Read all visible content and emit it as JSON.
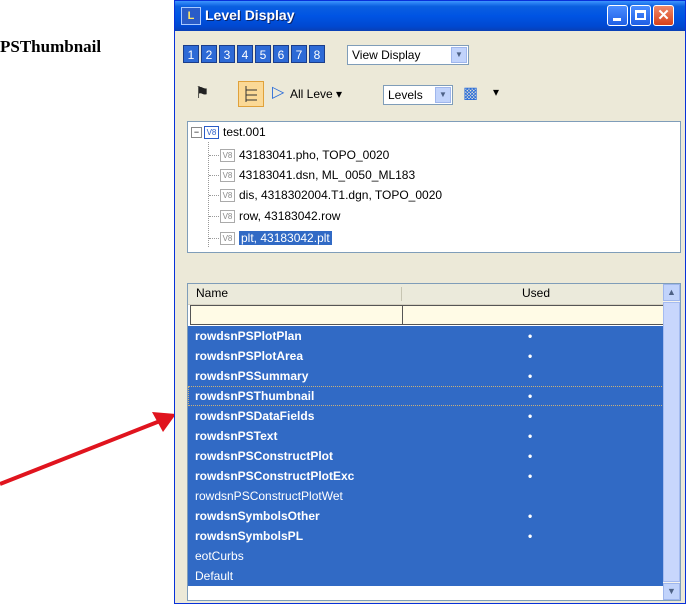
{
  "caption": "PSThumbnail",
  "window": {
    "title": "Level Display"
  },
  "level_buttons": [
    "1",
    "2",
    "3",
    "4",
    "5",
    "6",
    "7",
    "8"
  ],
  "view_display_select": "View Display",
  "toolbar": {
    "all_levels_label": "All Leve",
    "levels_select": "Levels"
  },
  "tree": {
    "root": "test.001",
    "children": [
      "43183041.pho, TOPO_0020",
      "43183041.dsn, ML_0050_ML183",
      "dis, 4318302004.T1.dgn, TOPO_0020",
      "row, 43183042.row",
      "plt, 43183042.plt"
    ]
  },
  "list": {
    "columns": [
      "Name",
      "Used"
    ],
    "rows": [
      {
        "name": "rowdsnPSPlotPlan",
        "used": "•"
      },
      {
        "name": "rowdsnPSPlotArea",
        "used": "•"
      },
      {
        "name": "rowdsnPSSummary",
        "used": "•"
      },
      {
        "name": "rowdsnPSThumbnail",
        "used": "•"
      },
      {
        "name": "rowdsnPSDataFields",
        "used": "•"
      },
      {
        "name": "rowdsnPSText",
        "used": "•"
      },
      {
        "name": "rowdsnPSConstructPlot",
        "used": "•"
      },
      {
        "name": "rowdsnPSConstructPlotExc",
        "used": "•"
      },
      {
        "name": "rowdsnPSConstructPlotWet",
        "used": ""
      },
      {
        "name": "rowdsnSymbolsOther",
        "used": "•"
      },
      {
        "name": "rowdsnSymbolsPL",
        "used": "•"
      },
      {
        "name": "eotCurbs",
        "used": ""
      },
      {
        "name": "Default",
        "used": ""
      }
    ]
  },
  "colors": {
    "selection": "#316ac5",
    "titlebar": "#0054e3",
    "arrow": "#e0141e"
  }
}
